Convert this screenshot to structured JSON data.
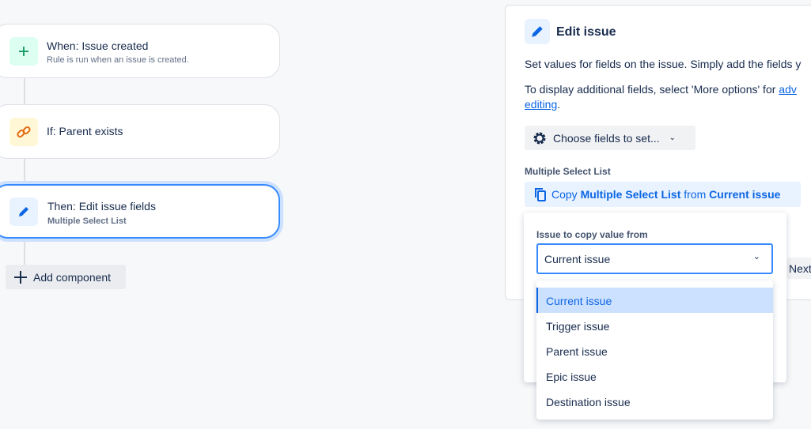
{
  "rule": {
    "trigger": {
      "title": "When: Issue created",
      "subtitle": "Rule is run when an issue is created."
    },
    "condition": {
      "title": "If: Parent exists"
    },
    "action": {
      "title": "Then: Edit issue fields",
      "subtitle": "Multiple Select List"
    },
    "add_component": "Add component"
  },
  "panel": {
    "title": "Edit issue",
    "desc": "Set values for fields on the issue. Simply add the fields y",
    "desc2_pre": "To display additional fields, select 'More options' for ",
    "desc2_link1": "adv",
    "desc2_link2": "editing",
    "desc2_post": ".",
    "choose_fields": "Choose fields to set...",
    "field_label": "Multiple Select List",
    "copy": {
      "w1": "Copy ",
      "w2": "Multiple Select List",
      "w3": " from ",
      "w4": "Current issue"
    },
    "next": "Next"
  },
  "popup": {
    "label": "Issue to copy value from",
    "selected": "Current issue",
    "options": [
      "Current issue",
      "Trigger issue",
      "Parent issue",
      "Epic issue",
      "Destination issue"
    ]
  }
}
